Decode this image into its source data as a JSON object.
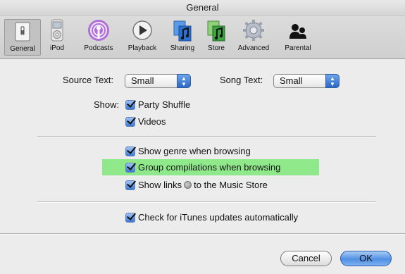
{
  "window": {
    "title": "General"
  },
  "toolbar": {
    "items": [
      {
        "label": "General",
        "icon": "general-switch-icon",
        "selected": true
      },
      {
        "label": "iPod",
        "icon": "ipod-icon",
        "selected": false
      },
      {
        "label": "Podcasts",
        "icon": "podcast-icon",
        "selected": false
      },
      {
        "label": "Playback",
        "icon": "play-icon",
        "selected": false
      },
      {
        "label": "Sharing",
        "icon": "sharing-music-icon",
        "selected": false
      },
      {
        "label": "Store",
        "icon": "store-music-icon",
        "selected": false
      },
      {
        "label": "Advanced",
        "icon": "gear-icon",
        "selected": false
      },
      {
        "label": "Parental",
        "icon": "parental-people-icon",
        "selected": false
      }
    ]
  },
  "general": {
    "source_text_label": "Source Text:",
    "source_text_value": "Small",
    "song_text_label": "Song Text:",
    "song_text_value": "Small",
    "show_label": "Show:",
    "party_shuffle": "Party Shuffle",
    "videos": "Videos",
    "show_genre": "Show genre when browsing",
    "group_compilations": "Group compilations when browsing",
    "show_links_before": "Show links",
    "show_links_after": "to the Music Store",
    "check_updates": "Check for iTunes updates automatically"
  },
  "buttons": {
    "cancel": "Cancel",
    "ok": "OK"
  },
  "colors": {
    "highlight": "#8fe98b",
    "accent": "#3b78d3"
  }
}
